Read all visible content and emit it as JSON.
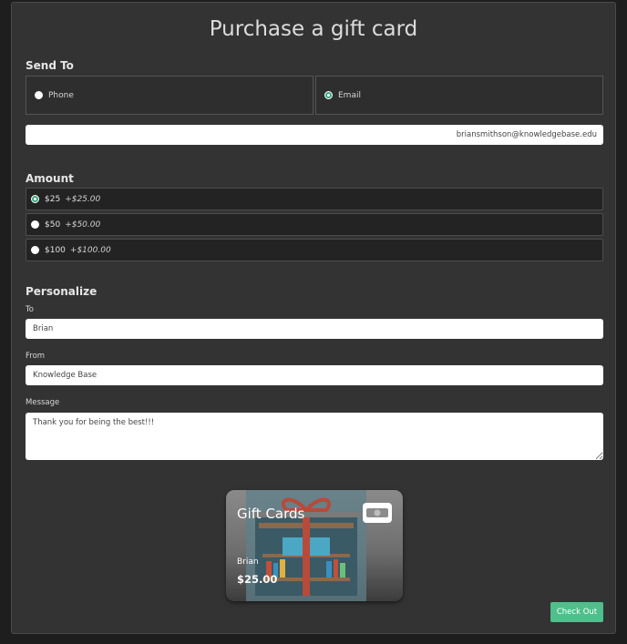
{
  "page": {
    "title": "Purchase a gift card"
  },
  "send_to": {
    "title": "Send To",
    "options": [
      {
        "label": "Phone",
        "selected": false
      },
      {
        "label": "Email",
        "selected": true
      }
    ],
    "email_value": "briansmithson@knowledgebase.edu"
  },
  "amount": {
    "title": "Amount",
    "options": [
      {
        "label": "$25",
        "extra": "+$25.00",
        "selected": true
      },
      {
        "label": "$50",
        "extra": "+$50.00",
        "selected": false
      },
      {
        "label": "$100",
        "extra": "+$100.00",
        "selected": false
      }
    ]
  },
  "personalize": {
    "title": "Personalize",
    "to_label": "To",
    "to_value": "Brian",
    "from_label": "From",
    "from_value": "Knowledge Base",
    "message_label": "Message",
    "message_value": "Thank you for being the best!!!"
  },
  "card": {
    "title": "Gift Cards",
    "name": "Brian",
    "amount": "$25.00",
    "logo_icon": "money-bill-icon"
  },
  "checkout_label": "Check Out",
  "colors": {
    "accent": "#4fbf8b",
    "radio_checked": "#3aa77a",
    "panel": "#333333"
  }
}
